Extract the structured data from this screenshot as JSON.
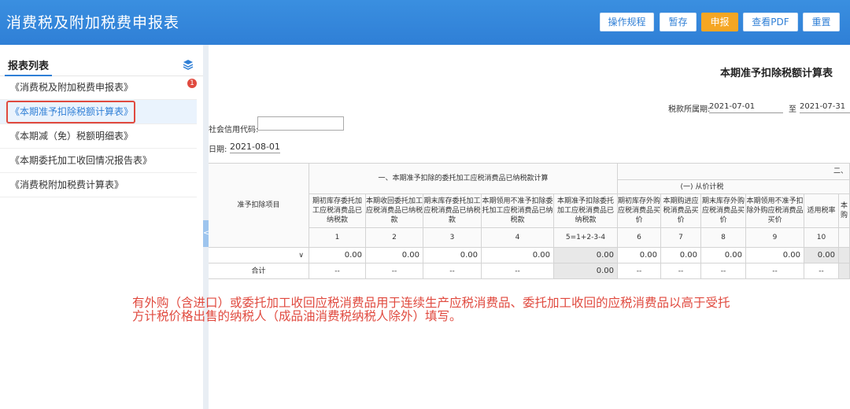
{
  "header": {
    "title": "消费税及附加税费申报表",
    "buttons": [
      "操作规程",
      "暂存",
      "申报",
      "查看PDF",
      "重置"
    ]
  },
  "sidebar": {
    "title": "报表列表",
    "badge": "1",
    "items": [
      "《消费税及附加税费申报表》",
      "《本期准予扣除税额计算表》",
      "《本期减（免）税额明细表》",
      "《本期委托加工收回情况报告表》",
      "《消费税附加税费计算表》"
    ],
    "active_index": 1
  },
  "form": {
    "title": "本期准予扣除税额计算表",
    "period_label": "税款所属期:",
    "period_start": "2021-07-01",
    "period_to": "至",
    "period_end": "2021-07-31",
    "credit_label": "社会信用代码:",
    "credit_value": "",
    "date_label": "日期:",
    "date_value": "2021-08-01"
  },
  "table": {
    "row_header": "准予扣除项目",
    "group1": "一、本期准予扣除的委托加工应税消费品已纳税款计算",
    "group2": "二、",
    "subgroup2": "(一) 从价计税",
    "headers": [
      "期初库存委托加工应税消费品已纳税款",
      "本期收回委托加工应税消费品已纳税款",
      "期末库存委托加工应税消费品已纳税款",
      "本期领用不准予扣除委托加工应税消费品已纳税款",
      "本期准予扣除委托加工应税消费品已纳税款",
      "期初库存外购应税消费品买价",
      "本期购进应税消费品买价",
      "期末库存外购应税消费品买价",
      "本期领用不准予扣除外购应税消费品买价",
      "适用税率",
      "本购"
    ],
    "col_numbers": [
      "1",
      "2",
      "3",
      "4",
      "5=1+2-3-4",
      "6",
      "7",
      "8",
      "9",
      "10",
      ""
    ],
    "row1_chevron": "∨",
    "row1": [
      "0.00",
      "0.00",
      "0.00",
      "0.00",
      "0.00",
      "0.00",
      "0.00",
      "0.00",
      "0.00",
      "0.00",
      ""
    ],
    "total_label": "合计",
    "row2": [
      "--",
      "--",
      "--",
      "--",
      "0.00",
      "--",
      "--",
      "--",
      "--",
      "--",
      ""
    ]
  },
  "note": "有外购（含进口）或委托加工收回应税消费品用于连续生产应税消费品、委托加工收回的应税消费品以高于受托方计税价格出售的纳税人（成品油消费税纳税人除外）填写。",
  "colors": {
    "accent": "#2f7fd6",
    "submit": "#f5a623",
    "highlight": "#e04a3f"
  }
}
